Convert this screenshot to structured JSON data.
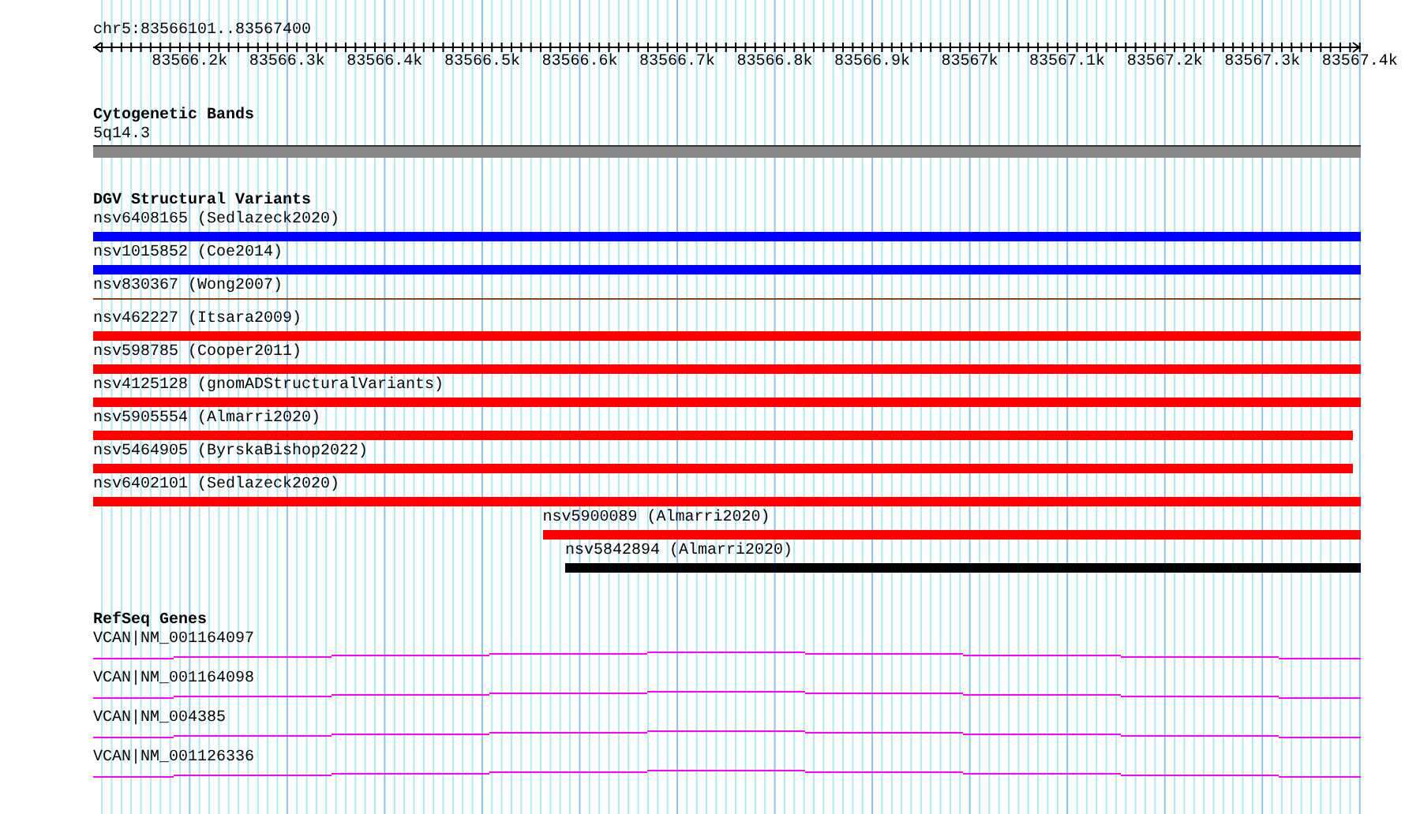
{
  "ruler": {
    "location": "chr5:83566101..83567400",
    "ticks": [
      "83566.2k",
      "83566.3k",
      "83566.4k",
      "83566.5k",
      "83566.6k",
      "83566.7k",
      "83566.8k",
      "83566.9k",
      "83567k",
      "83567.1k",
      "83567.2k",
      "83567.3k",
      "83567.4k"
    ]
  },
  "cytogenetic_bands": {
    "title": "Cytogenetic Bands",
    "bands": [
      {
        "name": "5q14.3",
        "color": "#888888"
      }
    ]
  },
  "structural_variants": {
    "title": "DGV Structural Variants",
    "features": [
      {
        "label": "nsv6408165 (Sedlazeck2020)",
        "kind": "bar",
        "color": "#0000ff"
      },
      {
        "label": "nsv1015852 (Coe2014)",
        "kind": "bar",
        "color": "#0000ff"
      },
      {
        "label": "nsv830367 (Wong2007)",
        "kind": "line",
        "color": "#8b4513"
      },
      {
        "label": "nsv462227 (Itsara2009)",
        "kind": "bar",
        "color": "#ff0000"
      },
      {
        "label": "nsv598785 (Cooper2011)",
        "kind": "bar",
        "color": "#ff0000"
      },
      {
        "label": "nsv4125128 (gnomADStructuralVariants)",
        "kind": "bar",
        "color": "#ff0000"
      },
      {
        "label": "nsv5905554 (Almarri2020)",
        "kind": "bar",
        "color": "#ff0000"
      },
      {
        "label": "nsv5464905 (ByrskaBishop2022)",
        "kind": "bar",
        "color": "#ff0000"
      },
      {
        "label": "nsv6402101 (Sedlazeck2020)",
        "kind": "bar",
        "color": "#ff0000"
      },
      {
        "label": "nsv5900089 (Almarri2020)",
        "kind": "bar",
        "color": "#ff0000"
      },
      {
        "label": "nsv5842894 (Almarri2020)",
        "kind": "bar",
        "color": "#000000"
      }
    ]
  },
  "refseq_genes": {
    "title": "RefSeq Genes",
    "genes": [
      {
        "label": "VCAN|NM_001164097"
      },
      {
        "label": "VCAN|NM_001164098"
      },
      {
        "label": "VCAN|NM_004385"
      },
      {
        "label": "VCAN|NM_001126336"
      }
    ]
  }
}
